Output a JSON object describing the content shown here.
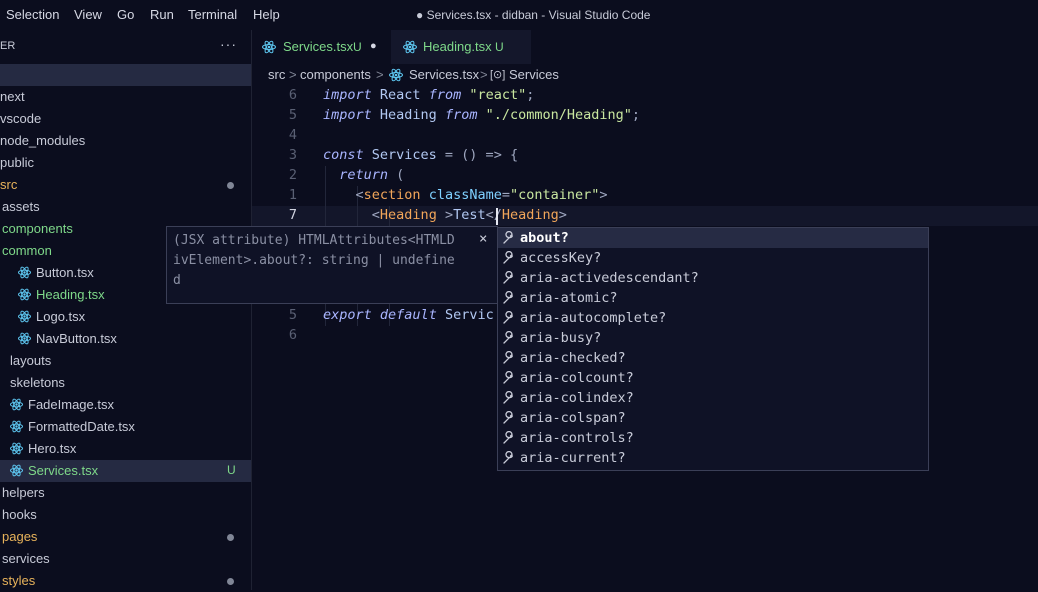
{
  "menubar": {
    "items": [
      "Selection",
      "View",
      "Go",
      "Run",
      "Terminal",
      "Help"
    ],
    "window_title": "● Services.tsx - didban - Visual Studio Code"
  },
  "sidebar": {
    "header": "ER",
    "more": "···",
    "items": [
      {
        "label": "",
        "kind": "root",
        "selected": true
      },
      {
        "label": "next",
        "kind": "folder"
      },
      {
        "label": "vscode",
        "kind": "folder"
      },
      {
        "label": "node_modules",
        "kind": "folder"
      },
      {
        "label": "public",
        "kind": "folder"
      },
      {
        "label": "src",
        "kind": "folder",
        "color": "#e8b35b",
        "dot": true
      },
      {
        "label": "assets",
        "kind": "folder"
      },
      {
        "label": "components",
        "kind": "folder",
        "color": "#7fd98a"
      },
      {
        "label": "common",
        "kind": "folder",
        "color": "#7fd98a"
      },
      {
        "label": "Button.tsx",
        "kind": "react"
      },
      {
        "label": "Heading.tsx",
        "kind": "react",
        "color": "#7fd98a"
      },
      {
        "label": "Logo.tsx",
        "kind": "react"
      },
      {
        "label": "NavButton.tsx",
        "kind": "react"
      },
      {
        "label": "layouts",
        "kind": "folder"
      },
      {
        "label": "skeletons",
        "kind": "folder"
      },
      {
        "label": "FadeImage.tsx",
        "kind": "react"
      },
      {
        "label": "FormattedDate.tsx",
        "kind": "react"
      },
      {
        "label": "Hero.tsx",
        "kind": "react"
      },
      {
        "label": "Services.tsx",
        "kind": "react",
        "color": "#7fd98a",
        "badge": "U",
        "selected": true
      },
      {
        "label": "helpers",
        "kind": "folder"
      },
      {
        "label": "hooks",
        "kind": "folder"
      },
      {
        "label": "pages",
        "kind": "folder",
        "color": "#e8b35b",
        "dot": true
      },
      {
        "label": "services",
        "kind": "folder"
      },
      {
        "label": "styles",
        "kind": "folder",
        "color": "#e8b35b",
        "dot": true
      }
    ]
  },
  "tabs": [
    {
      "label": "Services.tsx",
      "status": "U",
      "modified_dot": "●"
    },
    {
      "label": "Heading.tsx",
      "status": "U"
    }
  ],
  "breadcrumb": {
    "parts": [
      "src",
      "components",
      "Services.tsx",
      "Services"
    ],
    "sep": ">",
    "symbol_icon": "[⊙]"
  },
  "editor": {
    "line_numbers": [
      "6",
      "5",
      "4",
      "3",
      "2",
      "1",
      "7",
      "",
      "",
      "",
      "",
      "5",
      "6"
    ],
    "lines": [
      {
        "t": [
          [
            "kw",
            "import"
          ],
          [
            "id",
            " React "
          ],
          [
            "kw",
            "from"
          ],
          [
            "id",
            " "
          ],
          [
            "str",
            "\"react\""
          ],
          [
            "op",
            ";"
          ]
        ]
      },
      {
        "t": [
          [
            "kw",
            "import"
          ],
          [
            "id",
            " Heading "
          ],
          [
            "kw",
            "from"
          ],
          [
            "id",
            " "
          ],
          [
            "str",
            "\"./common/Heading\""
          ],
          [
            "op",
            ";"
          ]
        ]
      },
      {
        "t": []
      },
      {
        "t": [
          [
            "kw",
            "const"
          ],
          [
            "id",
            " Services "
          ],
          [
            "op",
            "= () => {"
          ]
        ]
      },
      {
        "t": [
          [
            "id",
            "  "
          ],
          [
            "kw",
            "return"
          ],
          [
            "op",
            " ("
          ]
        ]
      },
      {
        "t": [
          [
            "id",
            "    "
          ],
          [
            "op",
            "<"
          ],
          [
            "tag",
            "section"
          ],
          [
            "id",
            " "
          ],
          [
            "attr",
            "className"
          ],
          [
            "op",
            "="
          ],
          [
            "str",
            "\"container\""
          ],
          [
            "op",
            ">"
          ]
        ]
      },
      {
        "t": [
          [
            "id",
            "      "
          ],
          [
            "op",
            "<"
          ],
          [
            "tag",
            "Heading"
          ],
          [
            "id",
            " "
          ],
          [
            "op",
            ">"
          ],
          [
            "id",
            "Test"
          ],
          [
            "op",
            "</"
          ],
          [
            "tag",
            "Heading"
          ],
          [
            "op",
            ">"
          ]
        ]
      },
      {
        "t": []
      },
      {
        "t": []
      },
      {
        "t": []
      },
      {
        "t": []
      },
      {
        "t": [
          [
            "kw",
            "export"
          ],
          [
            "id",
            " "
          ],
          [
            "kw",
            "default"
          ],
          [
            "id",
            " Servic"
          ]
        ]
      },
      {
        "t": []
      }
    ]
  },
  "hover": {
    "lines": [
      "(JSX attribute) HTMLAttributes<HTMLD",
      "ivElement>.about?: string | undefine",
      "d"
    ],
    "close": "×"
  },
  "suggest": {
    "items": [
      "about?",
      "accessKey?",
      "aria-activedescendant?",
      "aria-atomic?",
      "aria-autocomplete?",
      "aria-busy?",
      "aria-checked?",
      "aria-colcount?",
      "aria-colindex?",
      "aria-colspan?",
      "aria-controls?",
      "aria-current?"
    ],
    "selected_index": 0,
    "icon": "wrench-icon"
  },
  "colors": {
    "background": "#0b0d1e",
    "accent_green": "#7fd98a",
    "accent_orange": "#e8b35b",
    "react_blue": "#5ec8f2"
  }
}
